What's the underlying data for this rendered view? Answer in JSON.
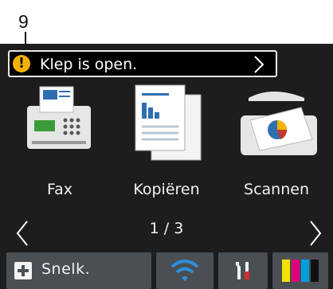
{
  "callout": {
    "number": "9"
  },
  "status": {
    "message": "Klep is open.",
    "warning_symbol": "!"
  },
  "tiles": [
    {
      "label": "Fax"
    },
    {
      "label": "Kopiëren"
    },
    {
      "label": "Scannen"
    }
  ],
  "pager": {
    "text": "1 / 3"
  },
  "bottom": {
    "shortcut_label": "Snelk."
  },
  "colors": {
    "warning": "#f5b200",
    "wifi": "#2f8fd8",
    "screen_bg": "#1d1d1d",
    "button_bg": "#4a4f54"
  }
}
